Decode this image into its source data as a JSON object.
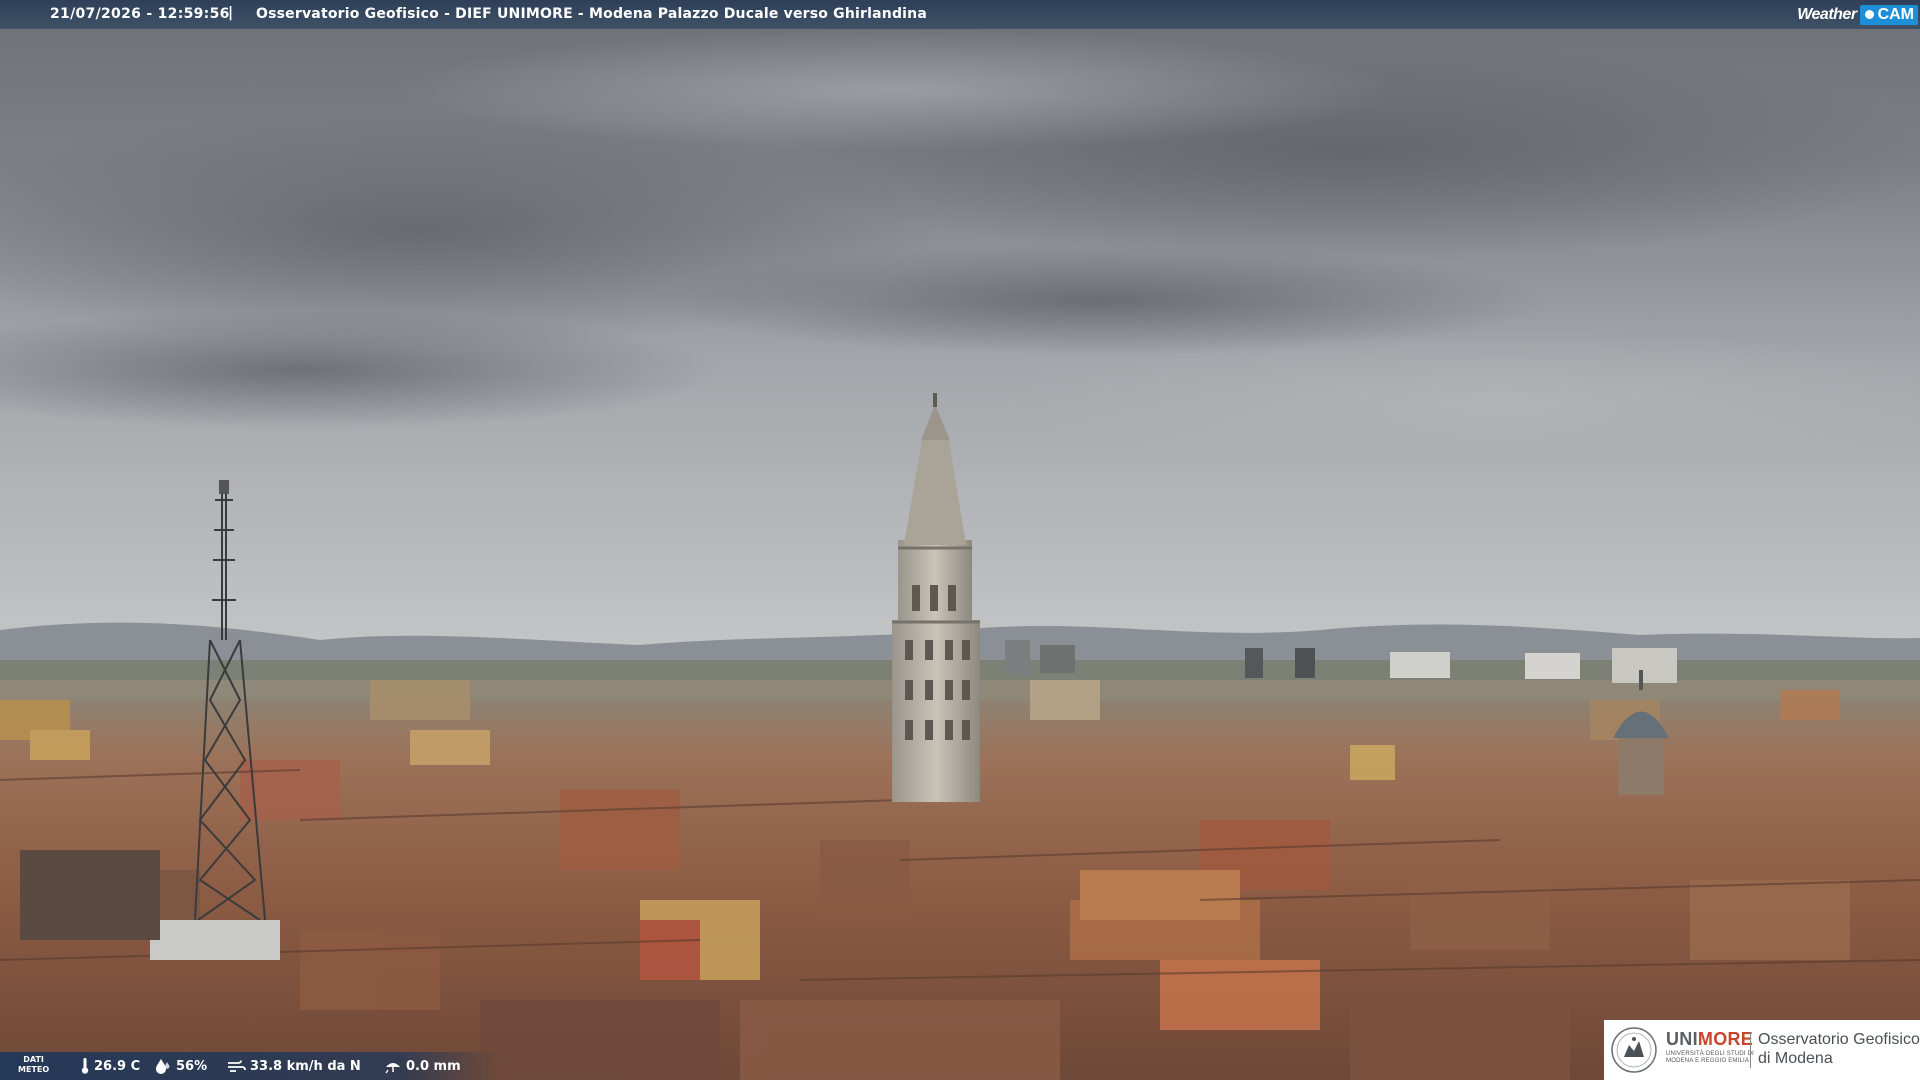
{
  "header": {
    "timestamp": "21/07/2026 - 12:59:56",
    "separator": "|",
    "camera_title": "Osservatorio Geofisico - DIEF UNIMORE - Modena Palazzo Ducale verso Ghirlandina"
  },
  "weathercam_logo": {
    "word1": "Weather",
    "word2": "CAM",
    "accent_color": "#1d8fd6"
  },
  "meteo": {
    "label_line1": "DATI",
    "label_line2": "METEO",
    "temperature": "26.9 C",
    "humidity": "56%",
    "wind": "33.8 km/h da N",
    "rain": "0.0 mm",
    "icons": [
      "thermometer-icon",
      "humidity-drop-icon",
      "wind-icon",
      "rain-icon"
    ]
  },
  "logo": {
    "uni": "UNI",
    "more": "MORE",
    "subtitle_line1": "UNIVERSITÀ DEGLI STUDI DI",
    "subtitle_line2": "MODENA E REGGIO EMILIA",
    "observatory_line1": "Osservatorio Geofisico",
    "observatory_line2": "di Modena",
    "more_color": "#c8442b"
  },
  "scene": {
    "description_icon": "webcam-landscape-image"
  }
}
